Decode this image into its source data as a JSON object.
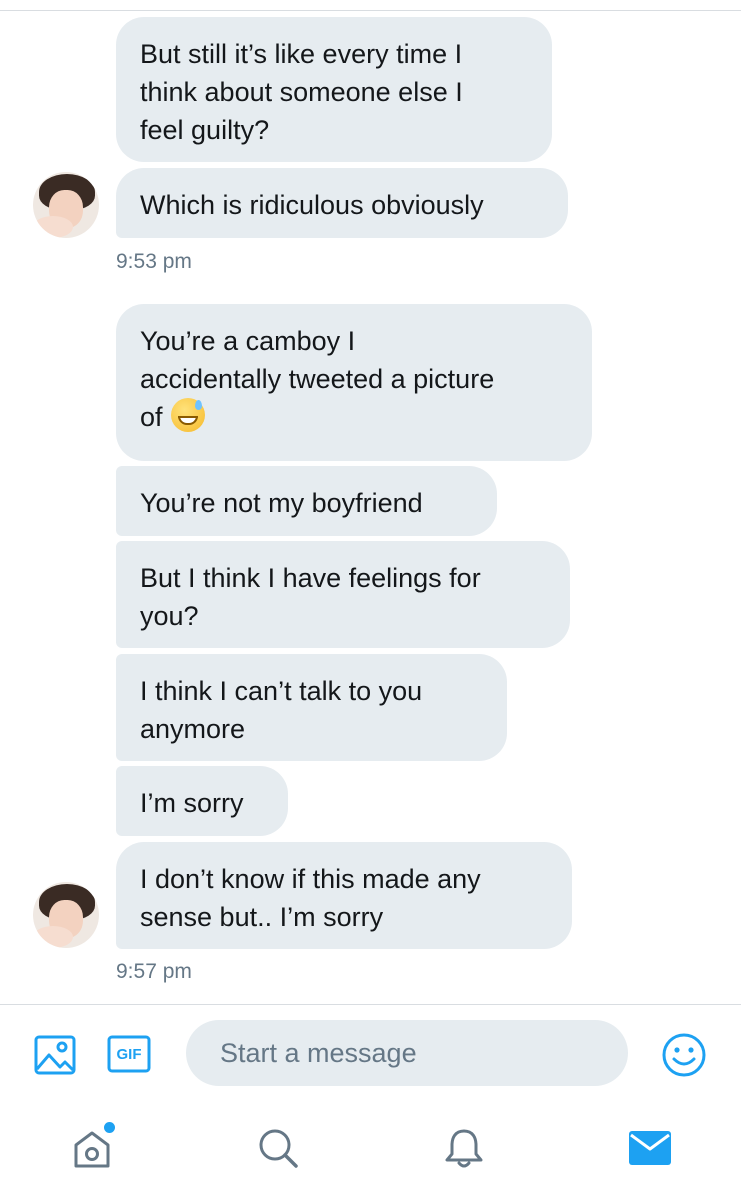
{
  "colors": {
    "accent": "#1da1f2",
    "bubble_bg": "#e6ecf0",
    "text": "#14171a",
    "muted": "#657786"
  },
  "group1": {
    "messages": [
      "But still it’s like every time I\nthink about someone else I\nfeel guilty?",
      "Which is ridiculous obviously"
    ],
    "timestamp": "9:53 pm"
  },
  "group2": {
    "messages": [
      "You’re a camboy I\naccidentally tweeted a picture\nof",
      "You’re not my boyfriend",
      "But I think I have feelings for\nyou?",
      "I think I can’t talk to you\nanymore",
      "I’m sorry",
      "I don’t know if this made any\nsense but.. I’m sorry"
    ],
    "emoji": "grinning-sweat-emoji",
    "timestamp": "9:57 pm"
  },
  "composer": {
    "placeholder": "Start a message",
    "gif_label": "GIF",
    "icons": [
      "image-icon",
      "gif-icon",
      "emoji-icon"
    ]
  },
  "tabbar": {
    "icons": [
      "home-icon",
      "search-icon",
      "notifications-icon",
      "messages-icon"
    ],
    "home_has_notification_dot": true
  }
}
